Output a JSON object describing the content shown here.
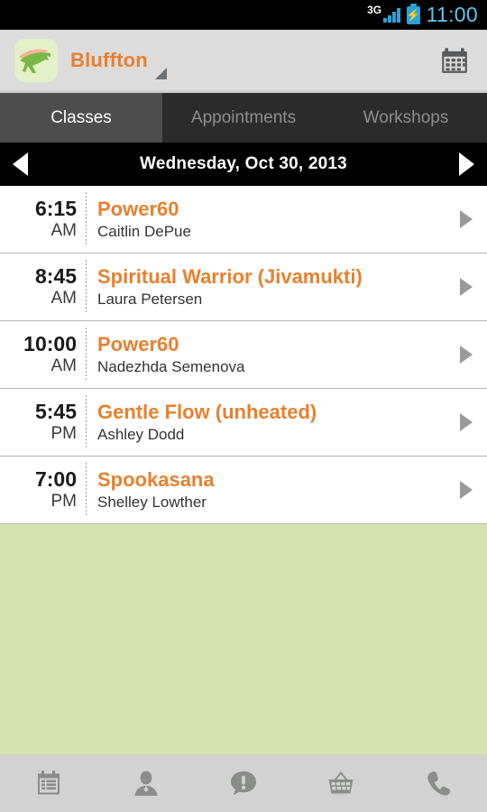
{
  "statusbar": {
    "network_label": "3G",
    "time": "11:00",
    "signal_icon": "signal-bars-icon",
    "battery_icon": "battery-charging-icon"
  },
  "header": {
    "brand": "Bluffton",
    "logo_icon": "app-logo-leaping-animal",
    "dropdown_icon": "dropdown-caret-icon",
    "calendar_icon": "calendar-icon",
    "brand_color": "#e8802e",
    "background": "#dcdcdc"
  },
  "tabs": [
    {
      "label": "Classes",
      "active": true
    },
    {
      "label": "Appointments",
      "active": false
    },
    {
      "label": "Workshops",
      "active": false
    }
  ],
  "datebar": {
    "date": "Wednesday, Oct 30, 2013",
    "prev_icon": "previous-day-arrow-icon",
    "next_icon": "next-day-arrow-icon"
  },
  "classes": [
    {
      "time": "6:15",
      "meridiem": "AM",
      "name": "Power60",
      "instructor": "Caitlin DePue"
    },
    {
      "time": "8:45",
      "meridiem": "AM",
      "name": "Spiritual Warrior (Jivamukti)",
      "instructor": "Laura Petersen"
    },
    {
      "time": "10:00",
      "meridiem": "AM",
      "name": "Power60",
      "instructor": "Nadezhda Semenova"
    },
    {
      "time": "5:45",
      "meridiem": "PM",
      "name": "Gentle Flow (unheated)",
      "instructor": "Ashley Dodd"
    },
    {
      "time": "7:00",
      "meridiem": "PM",
      "name": "Spookasana",
      "instructor": "Shelley Lowther"
    }
  ],
  "list": {
    "empty_background_color": "#d4e4b0",
    "row_chevron_icon": "chevron-right-icon"
  },
  "bottomnav": [
    {
      "icon": "schedule-icon"
    },
    {
      "icon": "profile-person-icon"
    },
    {
      "icon": "alert-bubble-icon"
    },
    {
      "icon": "shopping-basket-icon"
    },
    {
      "icon": "phone-icon"
    }
  ]
}
